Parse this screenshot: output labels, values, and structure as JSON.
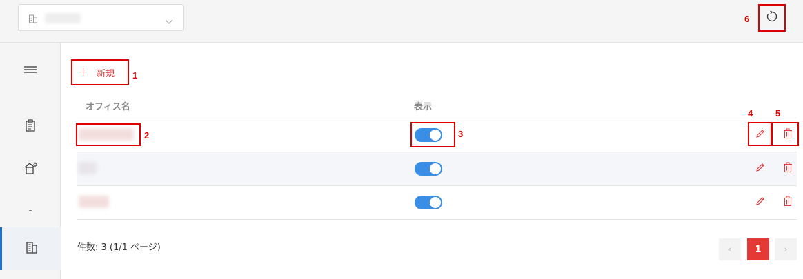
{
  "header": {
    "office_selector": {
      "value": "",
      "placeholder": ""
    }
  },
  "sidebar": {
    "items": [
      {
        "name": "menu-icon"
      },
      {
        "name": "clipboard-icon"
      },
      {
        "name": "house-settings-icon"
      },
      {
        "label": "-"
      },
      {
        "name": "building-icon",
        "active": true
      }
    ]
  },
  "toolbar": {
    "add_label": "新規"
  },
  "table": {
    "columns": [
      "オフィス名",
      "表示"
    ],
    "rows": [
      {
        "name": "",
        "visible": true
      },
      {
        "name": "",
        "visible": true
      },
      {
        "name": "",
        "visible": true
      }
    ]
  },
  "pagination": {
    "summary": "件数: 3 (1/1 ページ)",
    "current_page": "1",
    "prev_symbol": "‹",
    "next_symbol": "›"
  },
  "annotations": [
    "1",
    "2",
    "3",
    "4",
    "5",
    "6"
  ],
  "colors": {
    "accent_red": "#e53935",
    "toggle_blue": "#3a8ee6",
    "annotation_red": "#dd0000",
    "active_blue": "#1f6fd1"
  }
}
